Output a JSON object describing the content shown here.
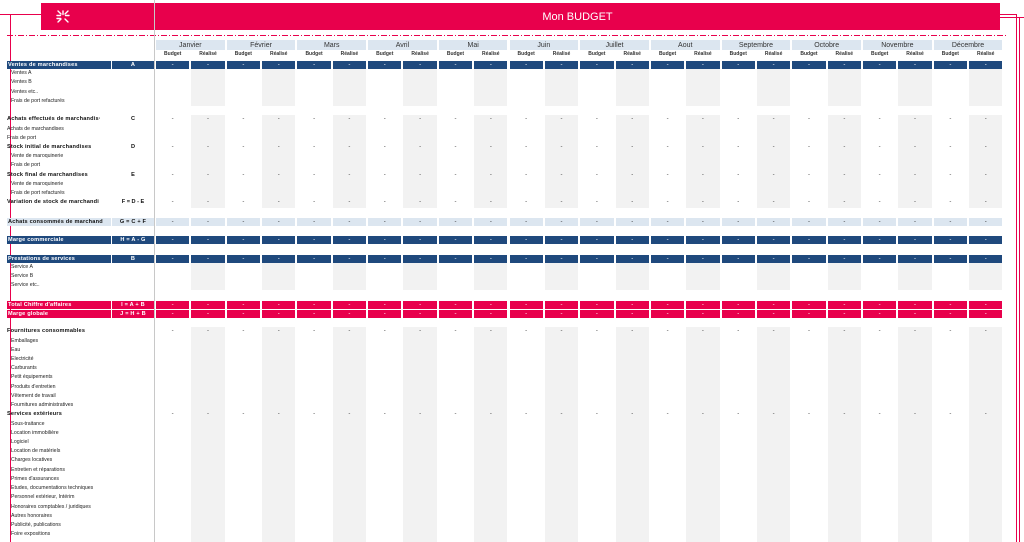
{
  "header": {
    "logo_icon": "burst-logo-icon",
    "title": "Mon BUDGET"
  },
  "colors": {
    "accent_pink": "#e8004c",
    "band_blue": "#1f497d",
    "band_light": "#dce6f0",
    "shade_gray": "#f2f2f2"
  },
  "columns": {
    "months": [
      "Janvier",
      "Février",
      "Mars",
      "Avril",
      "Mai",
      "Juin",
      "Juillet",
      "Aout",
      "Septembre",
      "Octobre",
      "Novembre",
      "Décembre"
    ],
    "sub": [
      "Budget",
      "Réalisé"
    ]
  },
  "empty_value": "-",
  "rows": [
    {
      "label": "Ventes de marchandises",
      "code": "A",
      "style": "blue"
    },
    {
      "label": "Ventes A",
      "style": "item"
    },
    {
      "label": "Ventes B",
      "style": "item"
    },
    {
      "label": "Ventes etc..",
      "style": "item"
    },
    {
      "label": "Frais de port refacturés",
      "style": "item"
    },
    {
      "label": "",
      "style": "blank"
    },
    {
      "label": "Achats effectués de marchandis·",
      "code": "C",
      "style": "bold-values"
    },
    {
      "label": "Achats de marchandises",
      "style": "item-flush"
    },
    {
      "label": "Frais de port",
      "style": "item-flush"
    },
    {
      "label": "Stock initial de marchandises",
      "code": "D",
      "style": "bold-values"
    },
    {
      "label": "Vente de maroquinerie",
      "style": "item"
    },
    {
      "label": "Frais de port",
      "style": "item"
    },
    {
      "label": "Stock final de marchandises",
      "code": "E",
      "style": "bold-values"
    },
    {
      "label": "Vente de maroquinerie",
      "style": "item"
    },
    {
      "label": "Frais de port refacturés",
      "style": "item"
    },
    {
      "label": "Variation de stock de marchandi",
      "code": "F = D - E",
      "style": "bold-values"
    },
    {
      "label": "",
      "style": "blank"
    },
    {
      "label": "Achats consommés de marchand",
      "code": "G = C + F",
      "style": "light"
    },
    {
      "label": "",
      "style": "blank"
    },
    {
      "label": "Marge commerciale",
      "code": "H = A - G",
      "style": "blue"
    },
    {
      "label": "",
      "style": "blank"
    },
    {
      "label": "Prestations de services",
      "code": "B",
      "style": "blue"
    },
    {
      "label": "Service A",
      "style": "item"
    },
    {
      "label": "Service B",
      "style": "item"
    },
    {
      "label": "Service etc..",
      "style": "item"
    },
    {
      "label": "",
      "style": "blank"
    },
    {
      "label": "Total Chiffre d'affaires",
      "code": "I = A + B",
      "style": "pink"
    },
    {
      "label": "Marge globale",
      "code": "J = H + B",
      "style": "pink"
    },
    {
      "label": "",
      "style": "blank"
    },
    {
      "label": "Fournitures consommables",
      "style": "bold-values"
    },
    {
      "label": "Emballages",
      "style": "item"
    },
    {
      "label": "Eau",
      "style": "item"
    },
    {
      "label": "Electricité",
      "style": "item"
    },
    {
      "label": "Carburants",
      "style": "item"
    },
    {
      "label": "Petit équipements",
      "style": "item"
    },
    {
      "label": "Produits d'entretien",
      "style": "item"
    },
    {
      "label": "Vêtement de travail",
      "style": "item"
    },
    {
      "label": "Fournitures administratives",
      "style": "item"
    },
    {
      "label": "Services extérieurs",
      "style": "bold-values"
    },
    {
      "label": "Sous-traitance",
      "style": "item"
    },
    {
      "label": "Location immobilière",
      "style": "item"
    },
    {
      "label": "Logiciel",
      "style": "item"
    },
    {
      "label": "Location de matériels",
      "style": "item"
    },
    {
      "label": "Charges locatives",
      "style": "item"
    },
    {
      "label": "Entretien et réparations",
      "style": "item"
    },
    {
      "label": "Primes d'assurances",
      "style": "item"
    },
    {
      "label": "Etudes, documentations techniques",
      "style": "item"
    },
    {
      "label": "Personnel extérieur, Intérim",
      "style": "item"
    },
    {
      "label": "Honoraires comptables / juridiques",
      "style": "item"
    },
    {
      "label": "Autres honoraires",
      "style": "item"
    },
    {
      "label": "Publicité, publications",
      "style": "item"
    },
    {
      "label": "Foire expositions",
      "style": "item"
    }
  ]
}
